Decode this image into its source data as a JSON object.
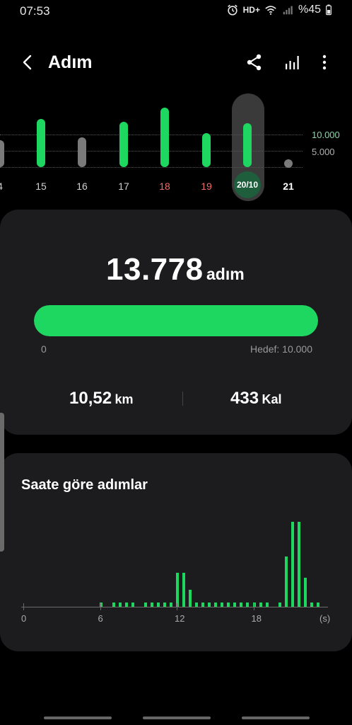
{
  "status": {
    "time": "07:53",
    "network": "HD+",
    "battery": "%45"
  },
  "appbar": {
    "title": "Adım"
  },
  "week": {
    "days": [
      {
        "label": "4",
        "fraction": 0.35,
        "color": "#7a7a7a",
        "label_color": "#d0d0d0"
      },
      {
        "label": "15",
        "fraction": 0.62,
        "color": "#1ed760",
        "label_color": "#d0d0d0"
      },
      {
        "label": "16",
        "fraction": 0.38,
        "color": "#7a7a7a",
        "label_color": "#d0d0d0"
      },
      {
        "label": "17",
        "fraction": 0.58,
        "color": "#1ed760",
        "label_color": "#d0d0d0"
      },
      {
        "label": "18",
        "fraction": 0.76,
        "color": "#1ed760",
        "label_color": "#f06a6a"
      },
      {
        "label": "19",
        "fraction": 0.44,
        "color": "#1ed760",
        "label_color": "#f06a6a"
      },
      {
        "label": "20/10",
        "fraction": 0.56,
        "color": "#1ed760",
        "label_color": "#ffffff",
        "selected": true
      },
      {
        "label": "21",
        "fraction": 0.0,
        "color": "#7a7a7a",
        "label_color": "#ffffff",
        "empty": true
      }
    ],
    "goal_label": "10.000",
    "mid_label": "5.000",
    "goal_color": "#8fd4a8",
    "mid_color": "#b0b0b0"
  },
  "summary": {
    "steps": "13.778",
    "unit": "adım",
    "progress_start": "0",
    "goal_text": "Hedef: 10.000",
    "progress_fraction": 1.0,
    "distance_value": "10,52",
    "distance_unit": "km",
    "calories_value": "433",
    "calories_unit": "Kal"
  },
  "hourly": {
    "title": "Saate göre adımlar",
    "axis_labels": [
      {
        "text": "0",
        "hour": 0
      },
      {
        "text": "6",
        "hour": 6
      },
      {
        "text": "12",
        "hour": 12
      },
      {
        "text": "18",
        "hour": 18
      },
      {
        "text": "(s)",
        "hour": 23.5
      }
    ],
    "bars": [
      {
        "hour": 6.0,
        "fraction": 0.05
      },
      {
        "hour": 7.0,
        "fraction": 0.05
      },
      {
        "hour": 7.5,
        "fraction": 0.05
      },
      {
        "hour": 8.0,
        "fraction": 0.05
      },
      {
        "hour": 8.5,
        "fraction": 0.05
      },
      {
        "hour": 9.5,
        "fraction": 0.05
      },
      {
        "hour": 10.0,
        "fraction": 0.05
      },
      {
        "hour": 10.5,
        "fraction": 0.05
      },
      {
        "hour": 11.0,
        "fraction": 0.05
      },
      {
        "hour": 11.5,
        "fraction": 0.05
      },
      {
        "hour": 12.0,
        "fraction": 0.4
      },
      {
        "hour": 12.5,
        "fraction": 0.4
      },
      {
        "hour": 13.0,
        "fraction": 0.2
      },
      {
        "hour": 13.5,
        "fraction": 0.05
      },
      {
        "hour": 14.0,
        "fraction": 0.05
      },
      {
        "hour": 14.5,
        "fraction": 0.05
      },
      {
        "hour": 15.0,
        "fraction": 0.05
      },
      {
        "hour": 15.5,
        "fraction": 0.05
      },
      {
        "hour": 16.0,
        "fraction": 0.05
      },
      {
        "hour": 16.5,
        "fraction": 0.05
      },
      {
        "hour": 17.0,
        "fraction": 0.05
      },
      {
        "hour": 17.5,
        "fraction": 0.05
      },
      {
        "hour": 18.0,
        "fraction": 0.05
      },
      {
        "hour": 18.5,
        "fraction": 0.05
      },
      {
        "hour": 19.0,
        "fraction": 0.05
      },
      {
        "hour": 20.0,
        "fraction": 0.05
      },
      {
        "hour": 20.5,
        "fraction": 0.59
      },
      {
        "hour": 21.0,
        "fraction": 1.0
      },
      {
        "hour": 21.5,
        "fraction": 1.0
      },
      {
        "hour": 22.0,
        "fraction": 0.34
      },
      {
        "hour": 22.5,
        "fraction": 0.05
      },
      {
        "hour": 23.0,
        "fraction": 0.05
      }
    ]
  },
  "colors": {
    "accent": "#1ed760",
    "card": "#1c1c1e",
    "background": "#000000"
  },
  "icons": [
    "alarm-icon",
    "wifi-icon",
    "signal-icon",
    "back-icon",
    "share-icon",
    "stats-icon",
    "more-icon"
  ]
}
